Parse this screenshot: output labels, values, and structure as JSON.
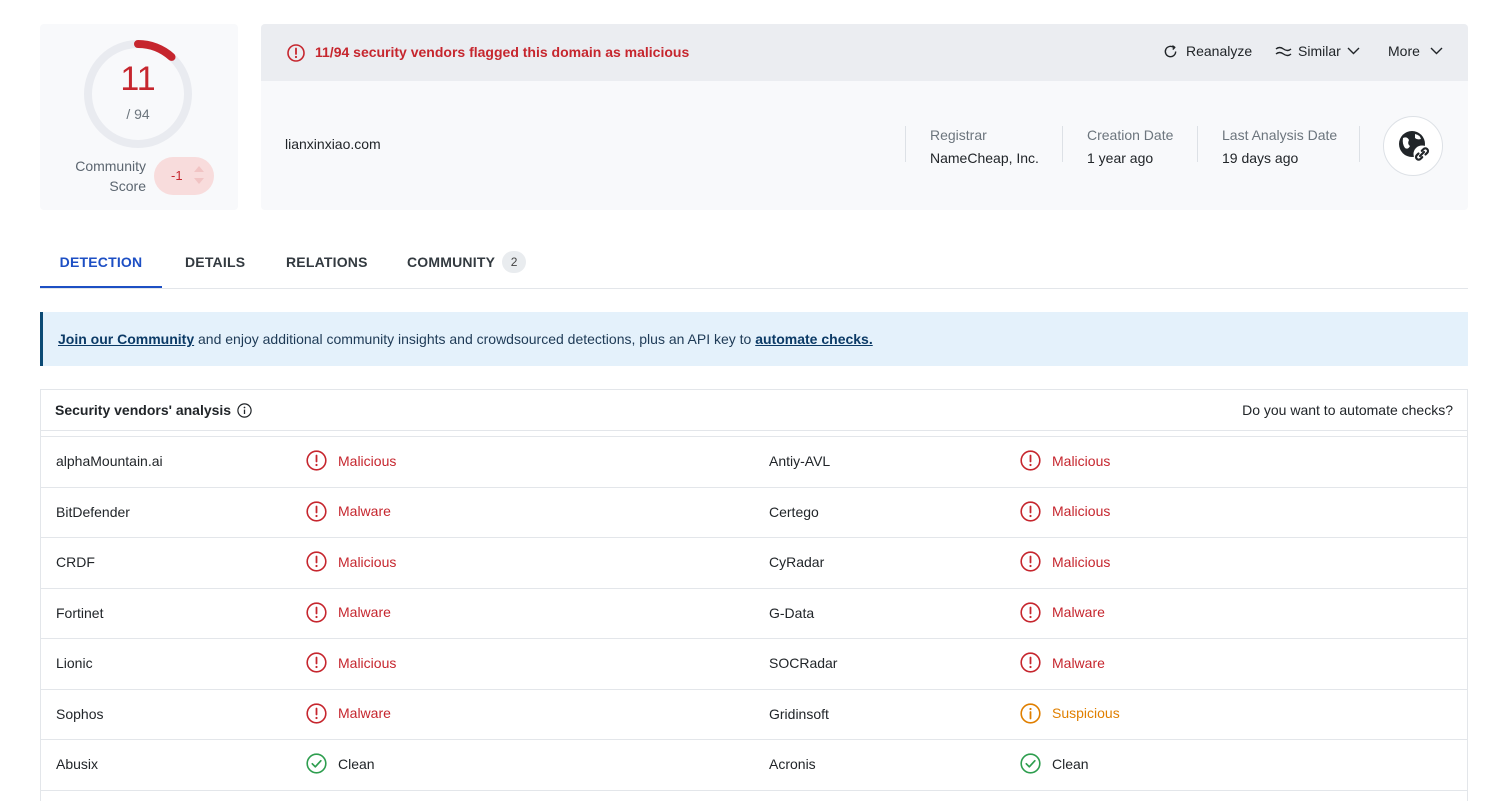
{
  "score": {
    "detections": "11",
    "total": "/ 94",
    "detections_count": 11,
    "total_count": 94,
    "gauge_color": "#c6262e",
    "community_label": "Community Score",
    "community_value": "-1"
  },
  "summary": {
    "alert_text": "11/94 security vendors flagged this domain as malicious",
    "actions": {
      "reanalyze": "Reanalyze",
      "similar": "Similar",
      "more": "More"
    },
    "domain": "lianxinxiao.com",
    "meta": {
      "registrar_label": "Registrar",
      "registrar_value": "NameCheap, Inc.",
      "creation_label": "Creation Date",
      "creation_value": "1 year ago",
      "analysis_label": "Last Analysis Date",
      "analysis_value": "19 days ago"
    },
    "domain_icon": "globe-link-icon"
  },
  "tabs": {
    "detection": "DETECTION",
    "details": "DETAILS",
    "relations": "RELATIONS",
    "community": "COMMUNITY",
    "community_badge": "2",
    "active": "detection"
  },
  "banner": {
    "link1": "Join our Community",
    "middle": " and enjoy additional community insights and crowdsourced detections, plus an API key to ",
    "link2": "automate checks."
  },
  "vendors": {
    "title": "Security vendors' analysis",
    "cta": "Do you want to automate checks?",
    "rows": [
      [
        {
          "name": "alphaMountain.ai",
          "result": "Malicious",
          "status": "malicious"
        },
        {
          "name": "Antiy-AVL",
          "result": "Malicious",
          "status": "malicious"
        }
      ],
      [
        {
          "name": "BitDefender",
          "result": "Malware",
          "status": "malicious"
        },
        {
          "name": "Certego",
          "result": "Malicious",
          "status": "malicious"
        }
      ],
      [
        {
          "name": "CRDF",
          "result": "Malicious",
          "status": "malicious"
        },
        {
          "name": "CyRadar",
          "result": "Malicious",
          "status": "malicious"
        }
      ],
      [
        {
          "name": "Fortinet",
          "result": "Malware",
          "status": "malicious"
        },
        {
          "name": "G-Data",
          "result": "Malware",
          "status": "malicious"
        }
      ],
      [
        {
          "name": "Lionic",
          "result": "Malicious",
          "status": "malicious"
        },
        {
          "name": "SOCRadar",
          "result": "Malware",
          "status": "malicious"
        }
      ],
      [
        {
          "name": "Sophos",
          "result": "Malware",
          "status": "malicious"
        },
        {
          "name": "Gridinsoft",
          "result": "Suspicious",
          "status": "suspicious"
        }
      ],
      [
        {
          "name": "Abusix",
          "result": "Clean",
          "status": "clean"
        },
        {
          "name": "Acronis",
          "result": "Clean",
          "status": "clean"
        }
      ],
      [
        {
          "name": "",
          "result": "",
          "status": "none"
        },
        {
          "name": "",
          "result": "",
          "status": "none"
        }
      ]
    ],
    "colors": {
      "malicious": "#c6262e",
      "suspicious": "#e07f00",
      "clean": "#2e9e4f"
    }
  }
}
